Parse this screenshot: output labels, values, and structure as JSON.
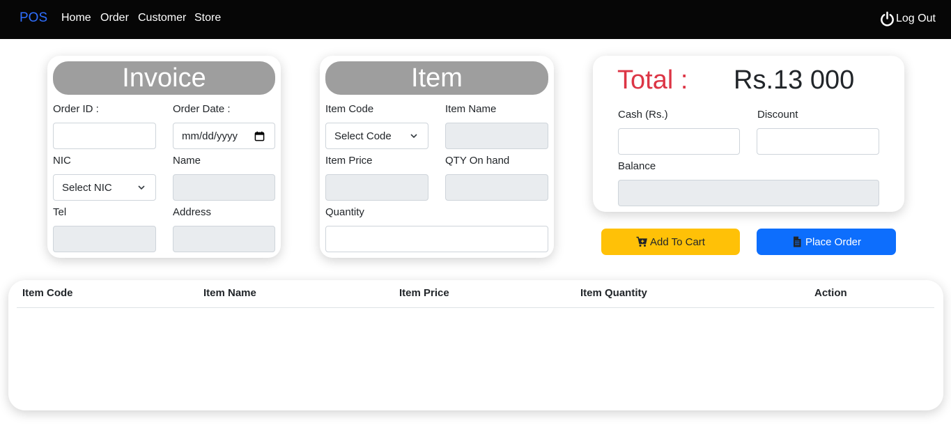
{
  "navbar": {
    "brand": "POS",
    "links": [
      "Home",
      "Order",
      "Customer",
      "Store"
    ],
    "logout_label": "Log Out",
    "logout_icon": "power-icon"
  },
  "invoice": {
    "title": "Invoice",
    "order_id_label": "Order ID :",
    "order_id_value": "",
    "order_date_label": "Order Date :",
    "order_date_placeholder": "mm/dd/yyyy",
    "nic_label": "NIC",
    "nic_selected": "Select NIC",
    "name_label": "Name",
    "tel_label": "Tel",
    "address_label": "Address"
  },
  "item": {
    "title": "Item",
    "item_code_label": "Item Code",
    "item_code_selected": "Select Code",
    "item_name_label": "Item Name",
    "item_price_label": "Item Price",
    "qty_on_hand_label": "QTY On hand",
    "quantity_label": "Quantity"
  },
  "summary": {
    "total_label": "Total :",
    "total_value": "Rs.13 000",
    "cash_label": "Cash (Rs.)",
    "discount_label": "Discount",
    "balance_label": "Balance"
  },
  "actions": {
    "add_to_cart": "Add To Cart",
    "place_order": "Place Order"
  },
  "cart_table": {
    "columns": [
      "Item Code",
      "Item Name",
      "Item Price",
      "Item Quantity",
      "Action"
    ],
    "rows": []
  },
  "colors": {
    "navbar": "#060606",
    "brand": "#2f6fff",
    "card_header": "#9e9e9e",
    "total_label": "#dc3545",
    "warning": "#ffc107",
    "primary": "#0d6efd"
  }
}
